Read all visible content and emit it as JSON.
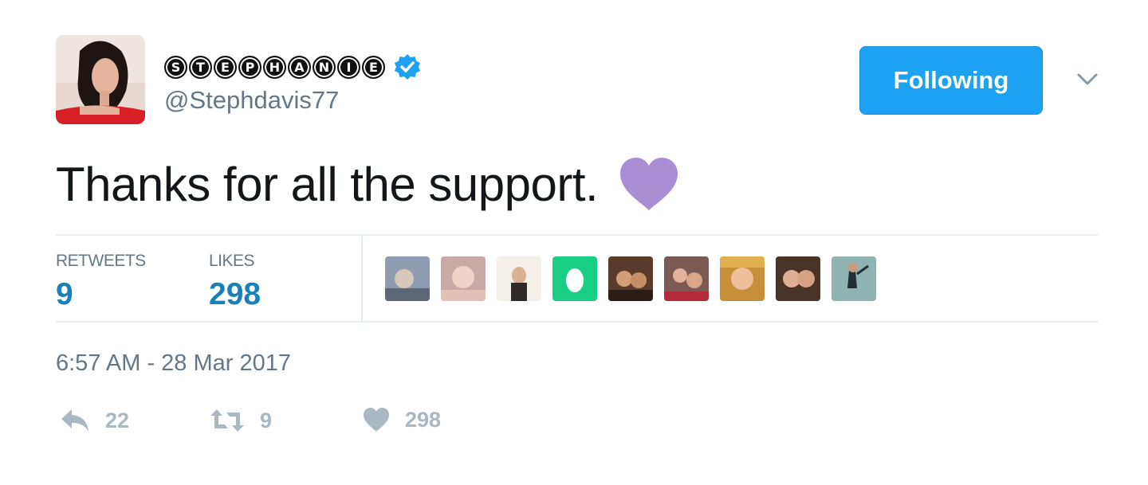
{
  "user": {
    "display_name_letters": [
      "S",
      "T",
      "E",
      "P",
      "H",
      "A",
      "N",
      "I",
      "E"
    ],
    "handle": "@Stephdavis77",
    "verified": true
  },
  "follow_button": {
    "label": "Following"
  },
  "tweet": {
    "text": "Thanks for all the support.",
    "emoji": "purple-heart"
  },
  "stats": {
    "retweets_label": "RETWEETS",
    "retweets_value": "9",
    "likes_label": "LIKES",
    "likes_value": "298"
  },
  "timestamp": "6:57 AM - 28 Mar 2017",
  "actions": {
    "reply_count": "22",
    "retweet_count": "9",
    "like_count": "298"
  },
  "colors": {
    "accent": "#1da1f2",
    "stat_value": "#1b7fb9",
    "muted": "#657786",
    "action_icon": "#aab8c2",
    "heart": "#a98ed6",
    "egg_bg": "#19cf86"
  }
}
